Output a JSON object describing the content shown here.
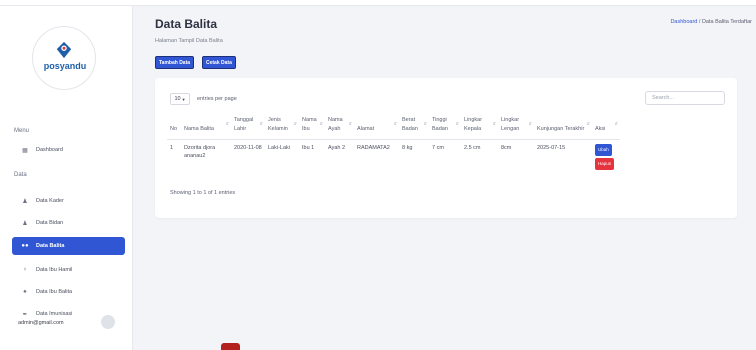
{
  "sidebar": {
    "logo_text": "posyandu",
    "section_menu": "Menu",
    "section_data": "Data",
    "items": [
      {
        "label": "Dashboard",
        "icon": "dashboard-icon"
      },
      {
        "label": "Data Kader",
        "icon": "user-icon"
      },
      {
        "label": "Data Bidan",
        "icon": "user-icon"
      },
      {
        "label": "Data Balita",
        "icon": "users-icon"
      },
      {
        "label": "Data Ibu Hamil",
        "icon": "pregnant-icon"
      },
      {
        "label": "Data Ibu Balita",
        "icon": "mother-child-icon"
      },
      {
        "label": "Data Imunisasi",
        "icon": "syringe-icon"
      }
    ],
    "user_email": "admin@gmail.com"
  },
  "header": {
    "title": "Data Balita",
    "subtitle": "Halaman Tampil Data Balita",
    "breadcrumb_home": "Dashboard",
    "breadcrumb_sep": "/",
    "breadcrumb_current": "Data Balita Terdaftar"
  },
  "toolbar": {
    "add_label": "Tambah Data",
    "print_label": "Cetak Data"
  },
  "table": {
    "length_value": "10",
    "length_label": "entries per page",
    "search_placeholder": "Search...",
    "columns": [
      "No",
      "Nama Balita",
      "Tanggal Lahir",
      "Jenis Kelamin",
      "Nama Ibu",
      "Nama Ayah",
      "Alamat",
      "Berat Badan",
      "Tinggi Badan",
      "Lingkar Kepala",
      "Lingkar Lengan",
      "Kunjungan Terakhir",
      "Aksi"
    ],
    "rows": [
      {
        "no": "1",
        "nama_balita": "Dzorita djora ananau2",
        "tanggal_lahir": "2020-11-08",
        "jenis_kelamin": "Laki-Laki",
        "nama_ibu": "Ibu 1",
        "nama_ayah": "Ayah 2",
        "alamat": "RADAMATA2",
        "berat_badan": "8 kg",
        "tinggi_badan": "7 cm",
        "lingkar_kepala": "2.5 cm",
        "lingkar_lengan": "8cm",
        "kunjungan_terakhir": "2025-07-15",
        "edit_label": "Ubah",
        "delete_label": "Hapus"
      }
    ],
    "info": "Showing 1 to 1 of 1 entries"
  },
  "colors": {
    "primary": "#3056d3",
    "danger": "#e5343d",
    "background": "#f3f4f8"
  }
}
